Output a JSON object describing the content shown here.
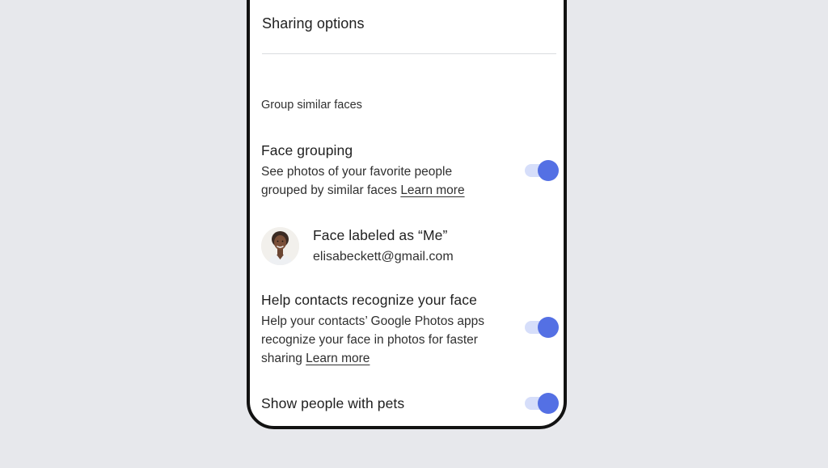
{
  "sharing": {
    "title": "Sharing options"
  },
  "group_faces": {
    "section_label": "Group similar faces",
    "face_grouping": {
      "title": "Face grouping",
      "desc_line1": "See photos of your favorite people",
      "desc_line2": "grouped by similar faces",
      "learn_more": "Learn more",
      "enabled": true
    },
    "face_label": {
      "title": "Face labeled as “Me”",
      "email": "elisabeckett@gmail.com"
    },
    "help_contacts": {
      "title": "Help contacts recognize your face",
      "desc_line1": "Help your contacts’ Google Photos apps",
      "desc_line2": "recognize your face in photos for faster",
      "desc_line3_prefix": "sharing",
      "learn_more": "Learn more",
      "enabled": true
    },
    "pets": {
      "title": "Show people with pets",
      "enabled": true
    }
  },
  "colors": {
    "background": "#e7e8ec",
    "toggle_thumb": "#5470e4",
    "toggle_track": "#d6defa"
  }
}
